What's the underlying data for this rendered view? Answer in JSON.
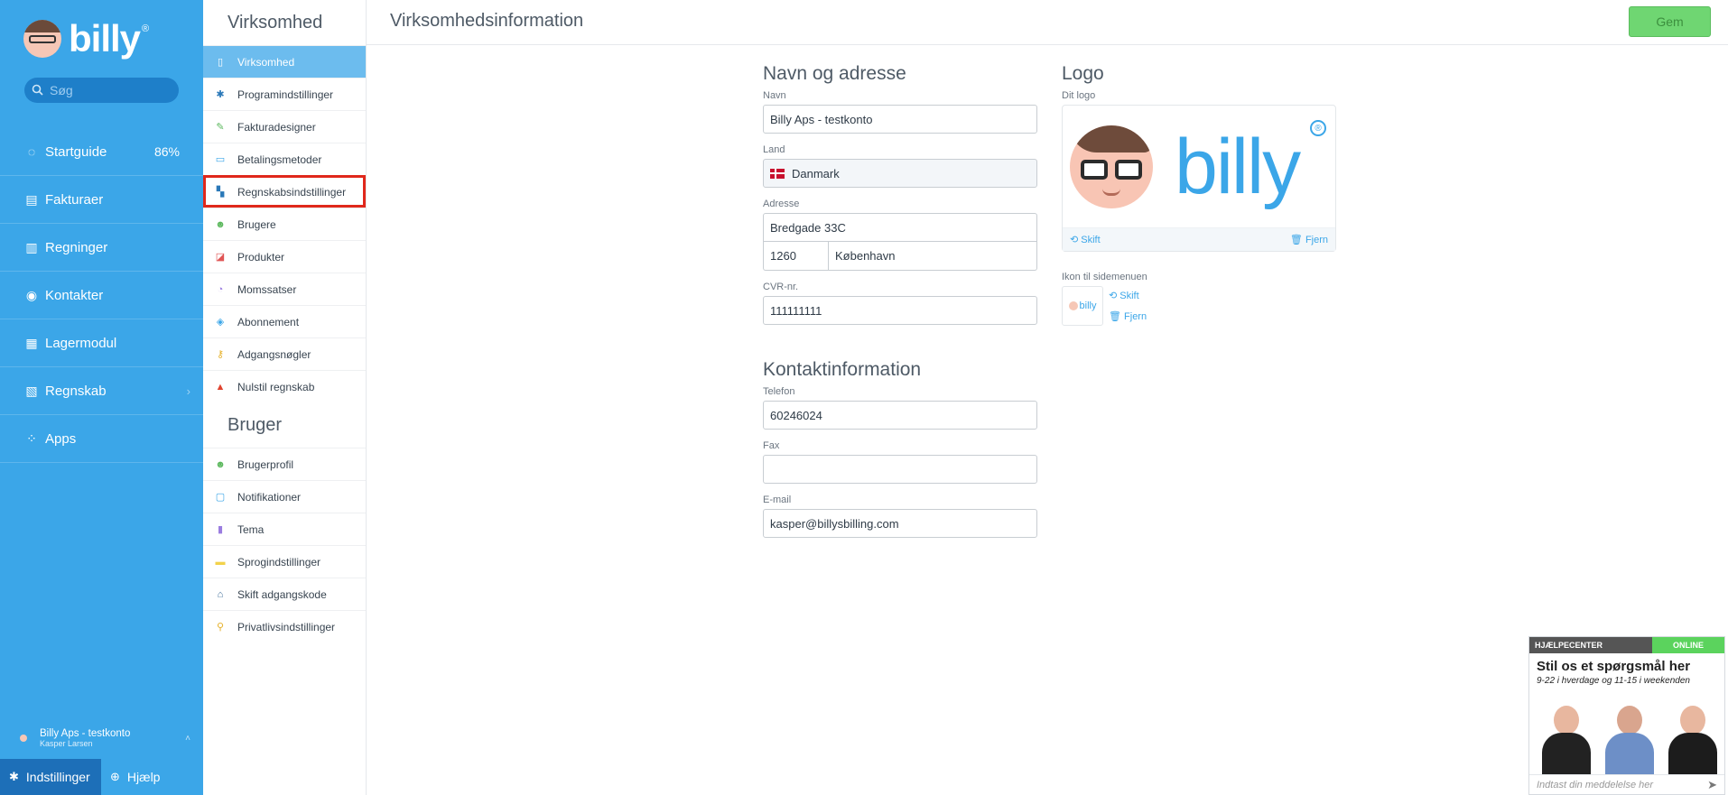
{
  "brand": {
    "name": "billy",
    "reg": "®"
  },
  "search": {
    "placeholder": "Søg"
  },
  "nav": [
    {
      "label": "Startguide",
      "icon": "progress-ring-icon",
      "glyph": "◌",
      "extra": "86%"
    },
    {
      "label": "Fakturaer",
      "icon": "invoice-icon",
      "glyph": "▤"
    },
    {
      "label": "Regninger",
      "icon": "bill-icon",
      "glyph": "▥"
    },
    {
      "label": "Kontakter",
      "icon": "contact-icon",
      "glyph": "◉"
    },
    {
      "label": "Lagermodul",
      "icon": "inventory-icon",
      "glyph": "▦"
    },
    {
      "label": "Regnskab",
      "icon": "accounting-icon",
      "glyph": "▧",
      "chevron": "›"
    },
    {
      "label": "Apps",
      "icon": "apps-icon",
      "glyph": "⁘"
    }
  ],
  "account": {
    "org": "Billy Aps - testkonto",
    "user": "Kasper Larsen",
    "chevron": "˄"
  },
  "bottom": {
    "settings": "Indstillinger",
    "help": "Hjælp"
  },
  "settings": {
    "company_title": "Virksomhed",
    "company_items": [
      {
        "label": "Virksomhed",
        "icon": "company-icon",
        "glyph": "▯",
        "color": "#ffffff"
      },
      {
        "label": "Programindstillinger",
        "icon": "gear-icon",
        "glyph": "✱",
        "color": "#2a78b8"
      },
      {
        "label": "Fakturadesigner",
        "icon": "design-icon",
        "glyph": "✎",
        "color": "#5bb85d"
      },
      {
        "label": "Betalingsmetoder",
        "icon": "payment-icon",
        "glyph": "▭",
        "color": "#3ba6e8"
      },
      {
        "label": "Regnskabsindstillinger",
        "icon": "accounting-settings-icon",
        "glyph": "▚",
        "color": "#2a78b8"
      },
      {
        "label": "Brugere",
        "icon": "users-icon",
        "glyph": "☻",
        "color": "#5bb85d"
      },
      {
        "label": "Produkter",
        "icon": "products-icon",
        "glyph": "◪",
        "color": "#e05555"
      },
      {
        "label": "Momssatser",
        "icon": "vat-icon",
        "glyph": "◔",
        "color": "#9b7de0"
      },
      {
        "label": "Abonnement",
        "icon": "subscription-icon",
        "glyph": "◈",
        "color": "#3ba6e8"
      },
      {
        "label": "Adgangsnøgler",
        "icon": "key-icon",
        "glyph": "⚷",
        "color": "#e6b12a"
      },
      {
        "label": "Nulstil regnskab",
        "icon": "warning-icon",
        "glyph": "▲",
        "color": "#e0432f"
      }
    ],
    "user_title": "Bruger",
    "user_items": [
      {
        "label": "Brugerprofil",
        "icon": "profile-icon",
        "glyph": "☻",
        "color": "#5bb85d"
      },
      {
        "label": "Notifikationer",
        "icon": "notification-icon",
        "glyph": "▢",
        "color": "#3ba6e8"
      },
      {
        "label": "Tema",
        "icon": "theme-icon",
        "glyph": "▮",
        "color": "#9b7de0"
      },
      {
        "label": "Sprogindstillinger",
        "icon": "language-icon",
        "glyph": "▬",
        "color": "#f2d24a"
      },
      {
        "label": "Skift adgangskode",
        "icon": "lock-icon",
        "glyph": "⌂",
        "color": "#3f6e99"
      },
      {
        "label": "Privatlivsindstillinger",
        "icon": "privacy-icon",
        "glyph": "⚲",
        "color": "#e6b12a"
      }
    ]
  },
  "header": {
    "title": "Virksomhedsinformation",
    "save": "Gem"
  },
  "form": {
    "name_address_title": "Navn og adresse",
    "name_label": "Navn",
    "name_value": "Billy Aps - testkonto",
    "country_label": "Land",
    "country_value": "Danmark",
    "address_label": "Adresse",
    "street_value": "Bredgade 33C",
    "zip_value": "1260",
    "city_value": "København",
    "cvr_label": "CVR-nr.",
    "cvr_value": "111111111",
    "contact_title": "Kontaktinformation",
    "phone_label": "Telefon",
    "phone_value": "60246024",
    "fax_label": "Fax",
    "fax_value": "",
    "email_label": "E-mail",
    "email_value": "kasper@billysbilling.com"
  },
  "logo": {
    "title": "Logo",
    "your_logo_label": "Dit logo",
    "change": "Skift",
    "remove": "Fjern",
    "sidebar_icon_label": "Ikon til sidemenuen",
    "icon_change": "Skift",
    "icon_remove": "Fjern",
    "thumb_word": "billy"
  },
  "help_widget": {
    "header": "HJÆLPECENTER",
    "status": "ONLINE",
    "title": "Stil os et spørgsmål her",
    "subtitle": "9-22 i hverdage og 11-15 i weekenden",
    "input_placeholder": "Indtast din meddelelse her"
  },
  "colors": {
    "sidebar": "#3ba6e8",
    "active_item": "#6cbcee",
    "highlight": "#e0281b",
    "save": "#6fd672"
  }
}
